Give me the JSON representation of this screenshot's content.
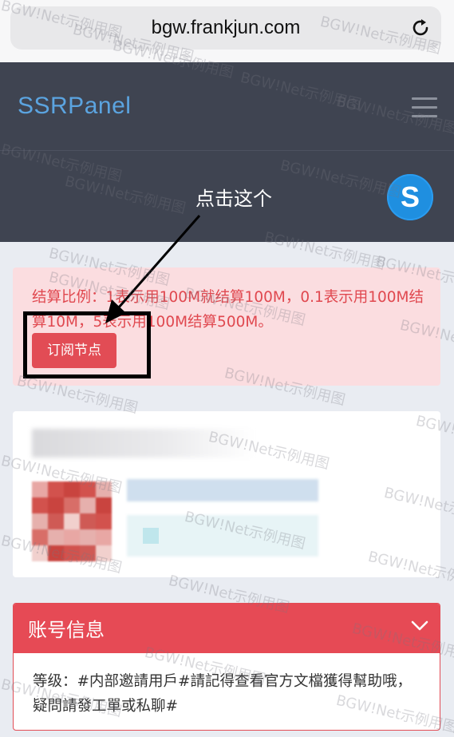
{
  "browser": {
    "url": "bgw.frankjun.com",
    "reload_icon": "reload-icon"
  },
  "header": {
    "brand": "SSRPanel",
    "menu_icon": "hamburger-menu-icon",
    "avatar_letter": "S"
  },
  "annotation": {
    "text": "点击这个"
  },
  "alert": {
    "text": "结算比例：1表示用100M就结算100M，0.1表示用100M结算10M，5表示用100M结算500M。",
    "button_label": "订阅节点"
  },
  "account": {
    "title": "账号信息",
    "level_text": "等级：#内部邀請用戶#請記得查看官方文檔獲得幫助哦，疑問請發工單或私聊#"
  },
  "watermark": "BGW!Net示例用图",
  "colors": {
    "header_bg": "#3f4451",
    "brand": "#5ba4e0",
    "alert_bg": "#fbdde0",
    "alert_text": "#e0484f",
    "danger": "#e24c55",
    "avatar": "#1f8fe0"
  }
}
